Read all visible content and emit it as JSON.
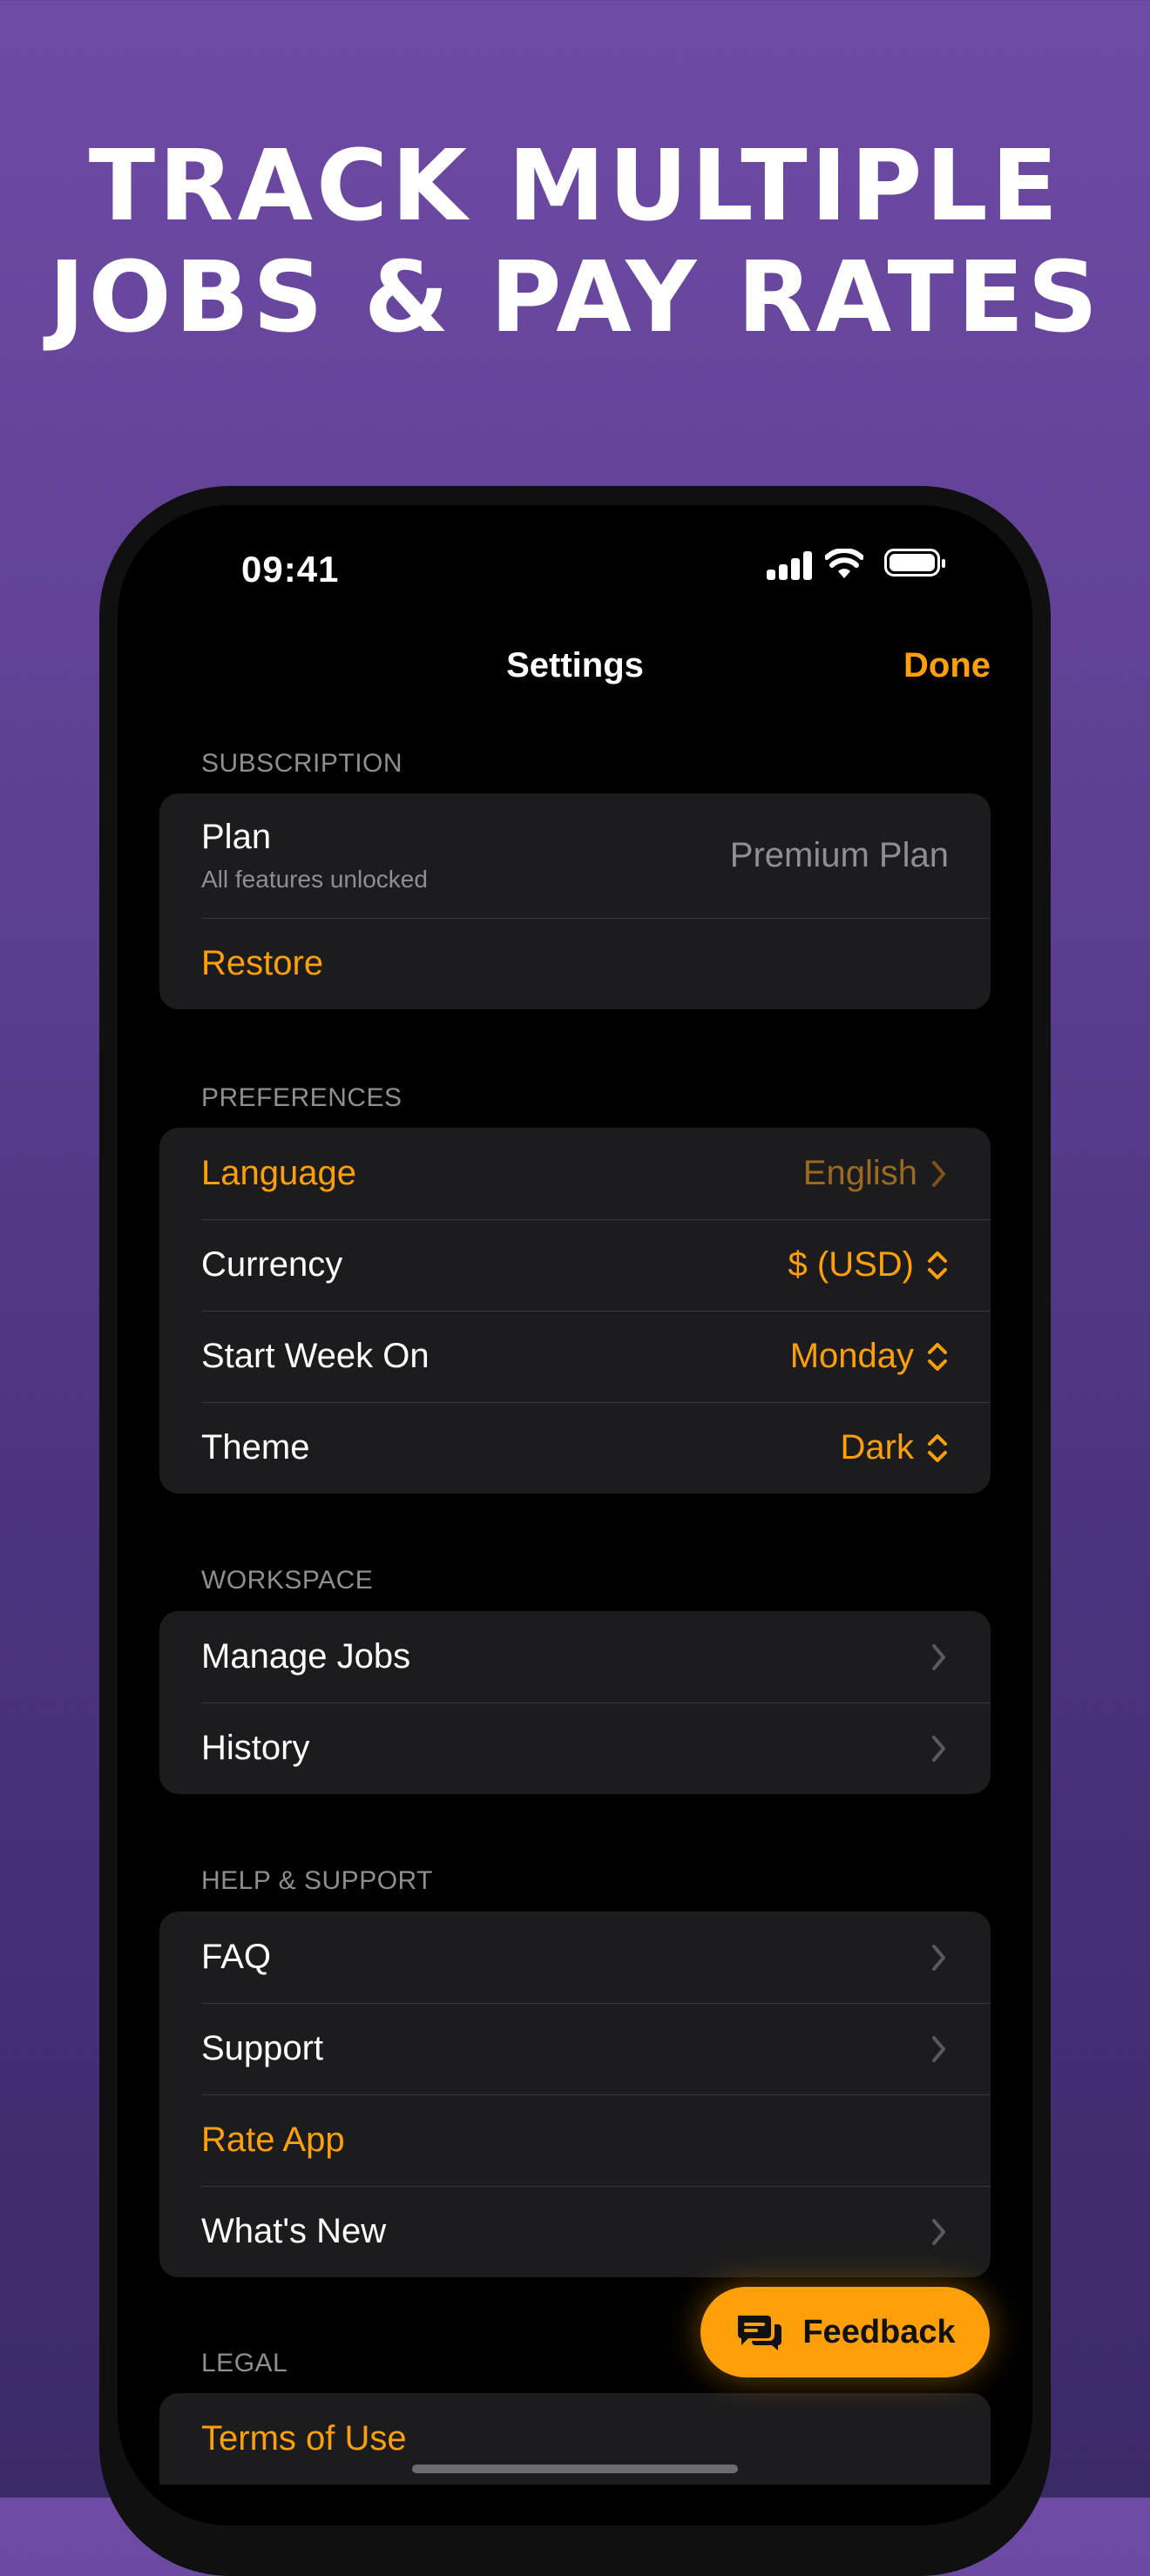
{
  "headline": {
    "line1": "TRACK MULTIPLE",
    "line2": "JOBS & PAY RATES"
  },
  "status_bar": {
    "time": "09:41"
  },
  "nav": {
    "title": "Settings",
    "done": "Done"
  },
  "sections": {
    "subscription": {
      "header": "SUBSCRIPTION",
      "plan_label": "Plan",
      "plan_sub": "All features unlocked",
      "plan_value": "Premium Plan",
      "restore": "Restore"
    },
    "preferences": {
      "header": "PREFERENCES",
      "language_label": "Language",
      "language_value": "English",
      "currency_label": "Currency",
      "currency_value": "$ (USD)",
      "week_label": "Start Week On",
      "week_value": "Monday",
      "theme_label": "Theme",
      "theme_value": "Dark"
    },
    "workspace": {
      "header": "WORKSPACE",
      "manage_jobs": "Manage Jobs",
      "history": "History"
    },
    "help": {
      "header": "HELP & SUPPORT",
      "faq": "FAQ",
      "support": "Support",
      "rate_app": "Rate App",
      "whats_new": "What's New"
    },
    "legal": {
      "header": "LEGAL",
      "terms": "Terms of Use"
    }
  },
  "feedback": {
    "label": "Feedback"
  },
  "colors": {
    "accent": "#ff9f0a",
    "background_top": "#6e4ba4",
    "background_bottom": "#3b2a68",
    "cell": "#1c1c1e"
  }
}
